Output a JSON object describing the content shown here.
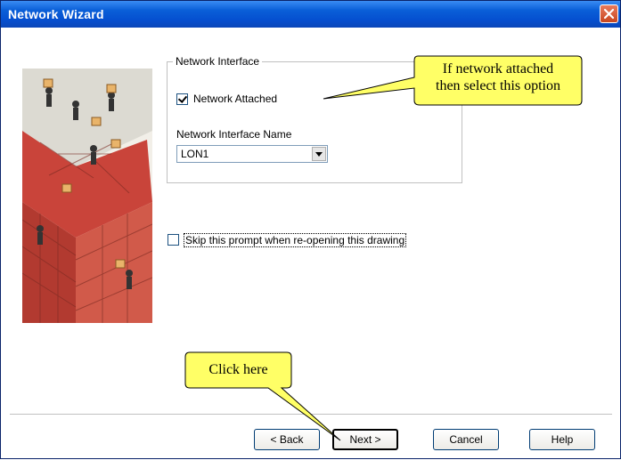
{
  "window": {
    "title": "Network Wizard",
    "close_icon": "close-icon"
  },
  "network_group": {
    "legend": "Network Interface",
    "network_attached": {
      "label": "Network Attached",
      "checked": true
    },
    "interface_name_label": "Network Interface Name",
    "interface_name_value": "LON1"
  },
  "skip_prompt": {
    "label": "Skip this prompt when re-opening this drawing",
    "checked": false
  },
  "buttons": {
    "back": "< Back",
    "next": "Next >",
    "cancel": "Cancel",
    "help": "Help"
  },
  "callouts": {
    "network_tip_line1": "If network attached",
    "network_tip_line2": "then select this option",
    "click_here": "Click here",
    "fill_color": "#ffff66"
  },
  "colors": {
    "title_bar": "#0550d0",
    "close_button": "#d4562b"
  }
}
